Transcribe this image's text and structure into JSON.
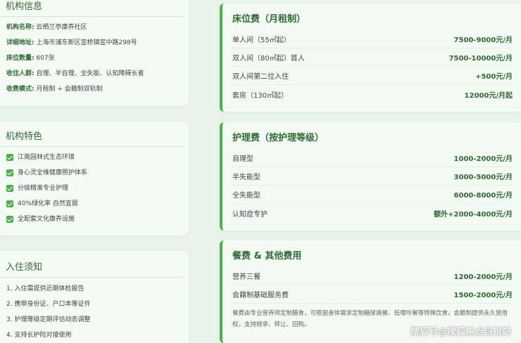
{
  "institution": {
    "title": "机构信息",
    "rows": [
      {
        "label": "机构名称:",
        "value": "云栖兰亭康养社区"
      },
      {
        "label": "详细地址:",
        "value": "上海市浦东新区宣桥镇宣中路298号"
      },
      {
        "label": "床位数量:",
        "value": "607张"
      },
      {
        "label": "收住人群:",
        "value": "自理、半自理、全失能、认知障碍长者"
      },
      {
        "label": "收费模式:",
        "value": "月租制 + 会籍制双轨制"
      }
    ]
  },
  "features": {
    "title": "机构特色",
    "items": [
      "江南园林式生态环境",
      "身心灵全维健康照护体系",
      "分级精准专业护理",
      "40%绿化率 自然宜居",
      "全配套文化康养设施"
    ]
  },
  "notice": {
    "title": "入住须知",
    "items": [
      "1. 入住需提供近期体检报告",
      "2. 携带身份证、户口本等证件",
      "3. 护理等级定期评估动态调整",
      "4. 支持长护险对接使用"
    ]
  },
  "bed_fee": {
    "title": "床位费（月租制）",
    "rows": [
      {
        "name": "单人间（55㎡起）",
        "price": "7500-9000元/月"
      },
      {
        "name": "双人间（80㎡起）首人",
        "price": "7500-10000元/月"
      },
      {
        "name": "双人间第二位入住",
        "price": "+500元/月"
      },
      {
        "name": "套房（130㎡起）",
        "price": "12000元/月起"
      }
    ]
  },
  "care_fee": {
    "title": "护理费（按护理等级）",
    "rows": [
      {
        "name": "自理型",
        "price": "1000-2000元/月"
      },
      {
        "name": "半失能型",
        "price": "3000-5000元/月"
      },
      {
        "name": "全失能型",
        "price": "6000-8000元/月"
      },
      {
        "name": "认知症专护",
        "price": "额外+2000-4000元/月"
      }
    ]
  },
  "meal_fee": {
    "title": "餐费 & 其他费用",
    "rows": [
      {
        "name": "营养三餐",
        "price": "1200-2000元/月"
      },
      {
        "name": "会籍制基础服务费",
        "price": "1500-2000元/月"
      }
    ],
    "note": "餐费由专业营养师定制膳食，可根据身体需求定制糖尿病餐、低嘌呤餐等特殊饮食。会籍制提供永久使用权，支持继承、转让、回购。"
  },
  "watermark": "搜狐号@搜狐焦点自银站"
}
